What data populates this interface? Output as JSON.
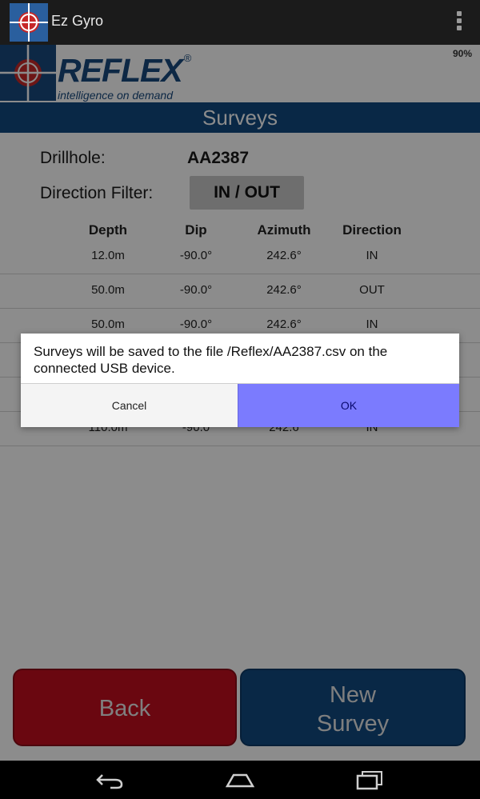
{
  "app": {
    "title": "Ez Gyro",
    "app_icon": "crosshair-icon",
    "overflow_icon": "overflow-menu-icon"
  },
  "status": {
    "battery": "90%"
  },
  "brand": {
    "name": "REFLEX",
    "registered": "®",
    "tagline": "intelligence on demand",
    "logo_icon": "crosshair-icon"
  },
  "screen_title": "Surveys",
  "drillhole": {
    "label": "Drillhole:",
    "value": "AA2387"
  },
  "filter": {
    "label": "Direction Filter:",
    "value": "IN / OUT"
  },
  "table": {
    "headers": [
      "Depth",
      "Dip",
      "Azimuth",
      "Direction"
    ],
    "rows": [
      [
        "12.0m",
        "-90.0°",
        "242.6°",
        "IN"
      ],
      [
        "50.0m",
        "-90.0°",
        "242.6°",
        "OUT"
      ],
      [
        "50.0m",
        "-90.0°",
        "242.6°",
        "IN"
      ],
      [
        "",
        "",
        "",
        ""
      ],
      [
        "",
        "",
        "",
        ""
      ],
      [
        "110.0m",
        "-90.0",
        "242.6",
        "IN"
      ]
    ]
  },
  "buttons": {
    "back": "Back",
    "new_line1": "New",
    "new_line2": "Survey"
  },
  "dialog": {
    "message": "Surveys will be saved to the file /Reflex/AA2387.csv on the connected USB device.",
    "cancel": "Cancel",
    "ok": "OK"
  },
  "nav": {
    "back_icon": "back-arrow-icon",
    "home_icon": "home-icon",
    "recents_icon": "recent-apps-icon"
  },
  "colors": {
    "brand_blue": "#114a80",
    "back_red": "#c20d1e",
    "ok_highlight": "#7b7bfe"
  }
}
